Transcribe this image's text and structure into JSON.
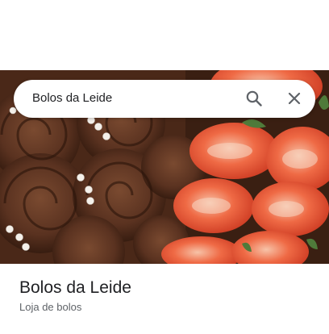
{
  "search": {
    "query": "Bolos da Leide"
  },
  "icons": {
    "search": "search-icon",
    "close": "close-icon"
  },
  "place": {
    "name": "Bolos da Leide",
    "category": "Loja de bolos"
  },
  "colors": {
    "text_primary": "#202124",
    "text_secondary": "#5f6368",
    "icon": "#5f6368"
  }
}
